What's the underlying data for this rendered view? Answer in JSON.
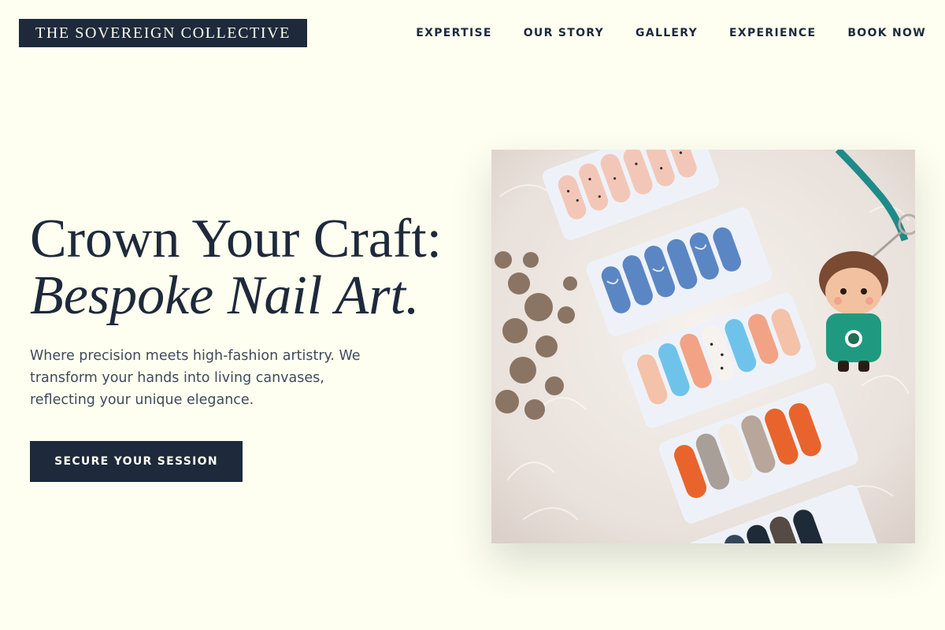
{
  "brand": {
    "name": "THE SOVEREIGN COLLECTIVE"
  },
  "nav": {
    "items": [
      {
        "label": "EXPERTISE"
      },
      {
        "label": "OUR STORY"
      },
      {
        "label": "GALLERY"
      },
      {
        "label": "EXPERIENCE"
      },
      {
        "label": "BOOK NOW"
      }
    ]
  },
  "hero": {
    "headline_line1": "Crown Your Craft:",
    "headline_line2": "Bespoke Nail Art.",
    "description": "Where precision meets high-fashion artistry. We transform your hands into living canvases, reflecting your unique elegance.",
    "cta_label": "SECURE YOUR SESSION",
    "image_alt": "Press-on nail sets displayed on a white fur rug"
  },
  "colors": {
    "background": "#fefff0",
    "primary": "#1e293b",
    "text_muted": "#3f4a5c"
  }
}
